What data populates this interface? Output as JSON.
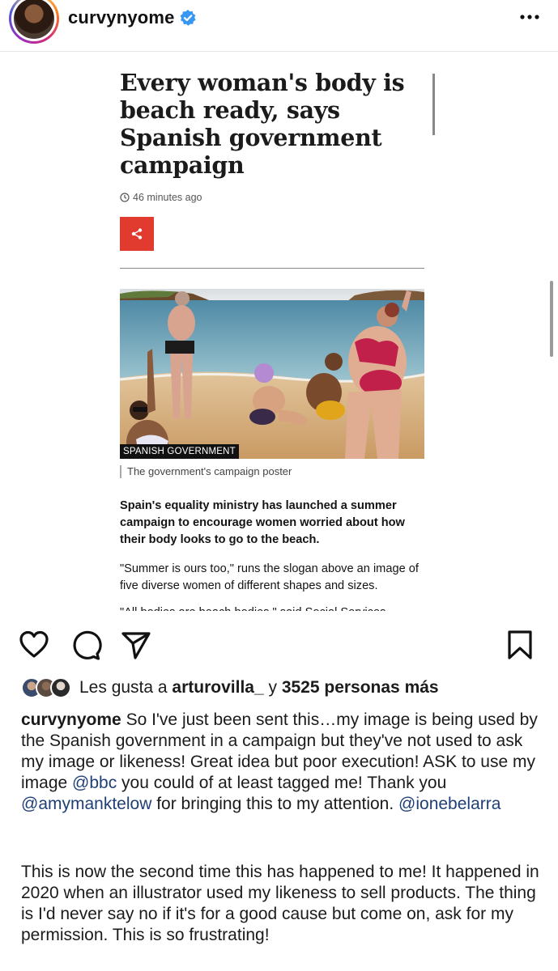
{
  "header": {
    "username": "curvynyome",
    "verified_icon": "verified-badge-icon",
    "more_icon": "more-horizontal-icon"
  },
  "article": {
    "headline": "Every woman's body is beach ready, says Spanish government campaign",
    "timestamp": "46 minutes ago",
    "share_icon": "share-icon",
    "image_credit": "SPANISH GOVERNMENT",
    "image_caption": "The government's campaign poster",
    "lead": "Spain's equality ministry has launched a summer campaign to encourage women worried about how their body looks to go to the beach.",
    "paragraph": "\"Summer is ours too,\" runs the slogan above an image of five diverse women of different shapes and sizes.",
    "paragraph_cut": "\"All bodies are beach bodies,\" said Social Services"
  },
  "actions": {
    "like_icon": "heart-icon",
    "comment_icon": "comment-icon",
    "share_icon": "send-icon",
    "save_icon": "bookmark-icon"
  },
  "likes": {
    "prefix": "Les gusta a ",
    "user": "arturovilla_",
    "middle": " y ",
    "count": "3525 personas más"
  },
  "caption": {
    "username": "curvynyome",
    "text_1": " So I've just been sent this…my image is being used by the Spanish government in a campaign but they've not used to ask my image or likeness! Great idea but poor execution! ASK to use my image ",
    "mention_1": "@bbc",
    "text_2": " you could of at least tagged me! Thank you ",
    "mention_2": "@amymanktelow",
    "text_3": " for bringing this to my attention. ",
    "mention_3": "@ionebelarra",
    "paragraph_2": "This is now the second time this has happened to me! It happened in 2020 when an illustrator used my likeness to sell products. The thing is I'd never say no if it's for a good cause but come on, ask for my permission. This is so frustrating!"
  },
  "colors": {
    "bbc_red": "#e13b2f",
    "mention_blue": "#1f3f78",
    "verified_blue": "#3897f0"
  }
}
